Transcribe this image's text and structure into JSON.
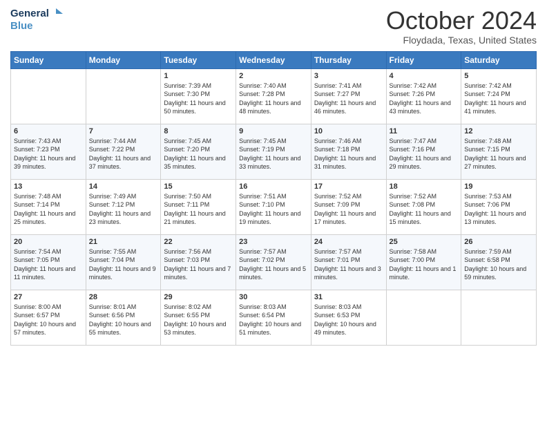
{
  "logo": {
    "line1": "General",
    "line2": "Blue"
  },
  "title": "October 2024",
  "location": "Floydada, Texas, United States",
  "weekdays": [
    "Sunday",
    "Monday",
    "Tuesday",
    "Wednesday",
    "Thursday",
    "Friday",
    "Saturday"
  ],
  "weeks": [
    [
      {
        "day": "",
        "sunrise": "",
        "sunset": "",
        "daylight": ""
      },
      {
        "day": "",
        "sunrise": "",
        "sunset": "",
        "daylight": ""
      },
      {
        "day": "1",
        "sunrise": "Sunrise: 7:39 AM",
        "sunset": "Sunset: 7:30 PM",
        "daylight": "Daylight: 11 hours and 50 minutes."
      },
      {
        "day": "2",
        "sunrise": "Sunrise: 7:40 AM",
        "sunset": "Sunset: 7:28 PM",
        "daylight": "Daylight: 11 hours and 48 minutes."
      },
      {
        "day": "3",
        "sunrise": "Sunrise: 7:41 AM",
        "sunset": "Sunset: 7:27 PM",
        "daylight": "Daylight: 11 hours and 46 minutes."
      },
      {
        "day": "4",
        "sunrise": "Sunrise: 7:42 AM",
        "sunset": "Sunset: 7:26 PM",
        "daylight": "Daylight: 11 hours and 43 minutes."
      },
      {
        "day": "5",
        "sunrise": "Sunrise: 7:42 AM",
        "sunset": "Sunset: 7:24 PM",
        "daylight": "Daylight: 11 hours and 41 minutes."
      }
    ],
    [
      {
        "day": "6",
        "sunrise": "Sunrise: 7:43 AM",
        "sunset": "Sunset: 7:23 PM",
        "daylight": "Daylight: 11 hours and 39 minutes."
      },
      {
        "day": "7",
        "sunrise": "Sunrise: 7:44 AM",
        "sunset": "Sunset: 7:22 PM",
        "daylight": "Daylight: 11 hours and 37 minutes."
      },
      {
        "day": "8",
        "sunrise": "Sunrise: 7:45 AM",
        "sunset": "Sunset: 7:20 PM",
        "daylight": "Daylight: 11 hours and 35 minutes."
      },
      {
        "day": "9",
        "sunrise": "Sunrise: 7:45 AM",
        "sunset": "Sunset: 7:19 PM",
        "daylight": "Daylight: 11 hours and 33 minutes."
      },
      {
        "day": "10",
        "sunrise": "Sunrise: 7:46 AM",
        "sunset": "Sunset: 7:18 PM",
        "daylight": "Daylight: 11 hours and 31 minutes."
      },
      {
        "day": "11",
        "sunrise": "Sunrise: 7:47 AM",
        "sunset": "Sunset: 7:16 PM",
        "daylight": "Daylight: 11 hours and 29 minutes."
      },
      {
        "day": "12",
        "sunrise": "Sunrise: 7:48 AM",
        "sunset": "Sunset: 7:15 PM",
        "daylight": "Daylight: 11 hours and 27 minutes."
      }
    ],
    [
      {
        "day": "13",
        "sunrise": "Sunrise: 7:48 AM",
        "sunset": "Sunset: 7:14 PM",
        "daylight": "Daylight: 11 hours and 25 minutes."
      },
      {
        "day": "14",
        "sunrise": "Sunrise: 7:49 AM",
        "sunset": "Sunset: 7:12 PM",
        "daylight": "Daylight: 11 hours and 23 minutes."
      },
      {
        "day": "15",
        "sunrise": "Sunrise: 7:50 AM",
        "sunset": "Sunset: 7:11 PM",
        "daylight": "Daylight: 11 hours and 21 minutes."
      },
      {
        "day": "16",
        "sunrise": "Sunrise: 7:51 AM",
        "sunset": "Sunset: 7:10 PM",
        "daylight": "Daylight: 11 hours and 19 minutes."
      },
      {
        "day": "17",
        "sunrise": "Sunrise: 7:52 AM",
        "sunset": "Sunset: 7:09 PM",
        "daylight": "Daylight: 11 hours and 17 minutes."
      },
      {
        "day": "18",
        "sunrise": "Sunrise: 7:52 AM",
        "sunset": "Sunset: 7:08 PM",
        "daylight": "Daylight: 11 hours and 15 minutes."
      },
      {
        "day": "19",
        "sunrise": "Sunrise: 7:53 AM",
        "sunset": "Sunset: 7:06 PM",
        "daylight": "Daylight: 11 hours and 13 minutes."
      }
    ],
    [
      {
        "day": "20",
        "sunrise": "Sunrise: 7:54 AM",
        "sunset": "Sunset: 7:05 PM",
        "daylight": "Daylight: 11 hours and 11 minutes."
      },
      {
        "day": "21",
        "sunrise": "Sunrise: 7:55 AM",
        "sunset": "Sunset: 7:04 PM",
        "daylight": "Daylight: 11 hours and 9 minutes."
      },
      {
        "day": "22",
        "sunrise": "Sunrise: 7:56 AM",
        "sunset": "Sunset: 7:03 PM",
        "daylight": "Daylight: 11 hours and 7 minutes."
      },
      {
        "day": "23",
        "sunrise": "Sunrise: 7:57 AM",
        "sunset": "Sunset: 7:02 PM",
        "daylight": "Daylight: 11 hours and 5 minutes."
      },
      {
        "day": "24",
        "sunrise": "Sunrise: 7:57 AM",
        "sunset": "Sunset: 7:01 PM",
        "daylight": "Daylight: 11 hours and 3 minutes."
      },
      {
        "day": "25",
        "sunrise": "Sunrise: 7:58 AM",
        "sunset": "Sunset: 7:00 PM",
        "daylight": "Daylight: 11 hours and 1 minute."
      },
      {
        "day": "26",
        "sunrise": "Sunrise: 7:59 AM",
        "sunset": "Sunset: 6:58 PM",
        "daylight": "Daylight: 10 hours and 59 minutes."
      }
    ],
    [
      {
        "day": "27",
        "sunrise": "Sunrise: 8:00 AM",
        "sunset": "Sunset: 6:57 PM",
        "daylight": "Daylight: 10 hours and 57 minutes."
      },
      {
        "day": "28",
        "sunrise": "Sunrise: 8:01 AM",
        "sunset": "Sunset: 6:56 PM",
        "daylight": "Daylight: 10 hours and 55 minutes."
      },
      {
        "day": "29",
        "sunrise": "Sunrise: 8:02 AM",
        "sunset": "Sunset: 6:55 PM",
        "daylight": "Daylight: 10 hours and 53 minutes."
      },
      {
        "day": "30",
        "sunrise": "Sunrise: 8:03 AM",
        "sunset": "Sunset: 6:54 PM",
        "daylight": "Daylight: 10 hours and 51 minutes."
      },
      {
        "day": "31",
        "sunrise": "Sunrise: 8:03 AM",
        "sunset": "Sunset: 6:53 PM",
        "daylight": "Daylight: 10 hours and 49 minutes."
      },
      {
        "day": "",
        "sunrise": "",
        "sunset": "",
        "daylight": ""
      },
      {
        "day": "",
        "sunrise": "",
        "sunset": "",
        "daylight": ""
      }
    ]
  ]
}
